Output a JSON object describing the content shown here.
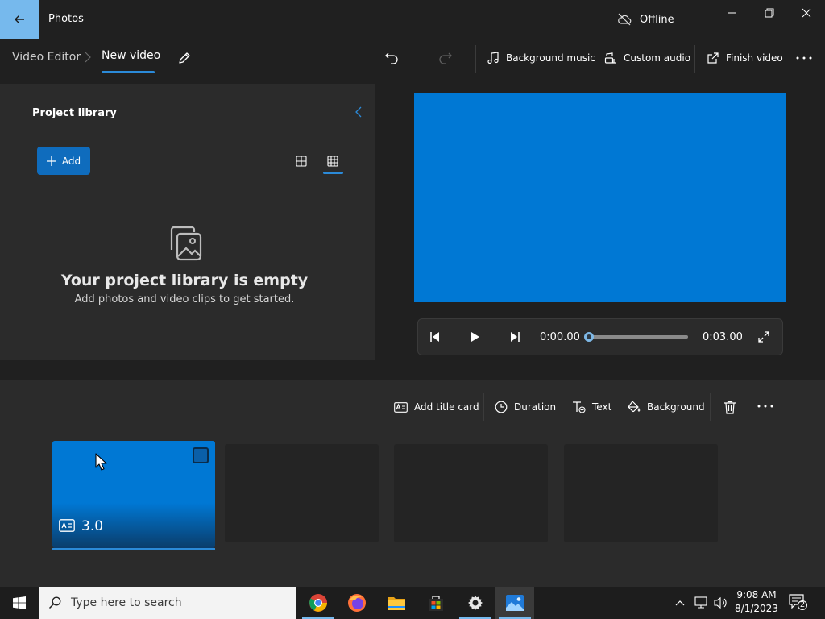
{
  "window": {
    "app_title": "Photos",
    "status": "Offline"
  },
  "toolbar": {
    "breadcrumb_root": "Video Editor",
    "project_name": "New video",
    "background_music": "Background music",
    "custom_audio": "Custom audio",
    "finish_video": "Finish video"
  },
  "library": {
    "title": "Project library",
    "add_label": "Add",
    "empty_title": "Your project library is empty",
    "empty_subtitle": "Add photos and video clips to get started."
  },
  "player": {
    "current_time": "0:00.00",
    "total_time": "0:03.00",
    "progress": 0
  },
  "storyboard": {
    "add_title_card": "Add title card",
    "duration": "Duration",
    "text": "Text",
    "background": "Background",
    "cards": [
      {
        "duration": "3.0"
      }
    ]
  },
  "taskbar": {
    "search_placeholder": "Type here to search",
    "time": "9:08 AM",
    "date": "8/1/2023",
    "notification_count": "2"
  },
  "colors": {
    "accent": "#0078d4",
    "button_blue": "#0f6cbd",
    "background": "#202020",
    "panel": "#2b2b2b"
  }
}
